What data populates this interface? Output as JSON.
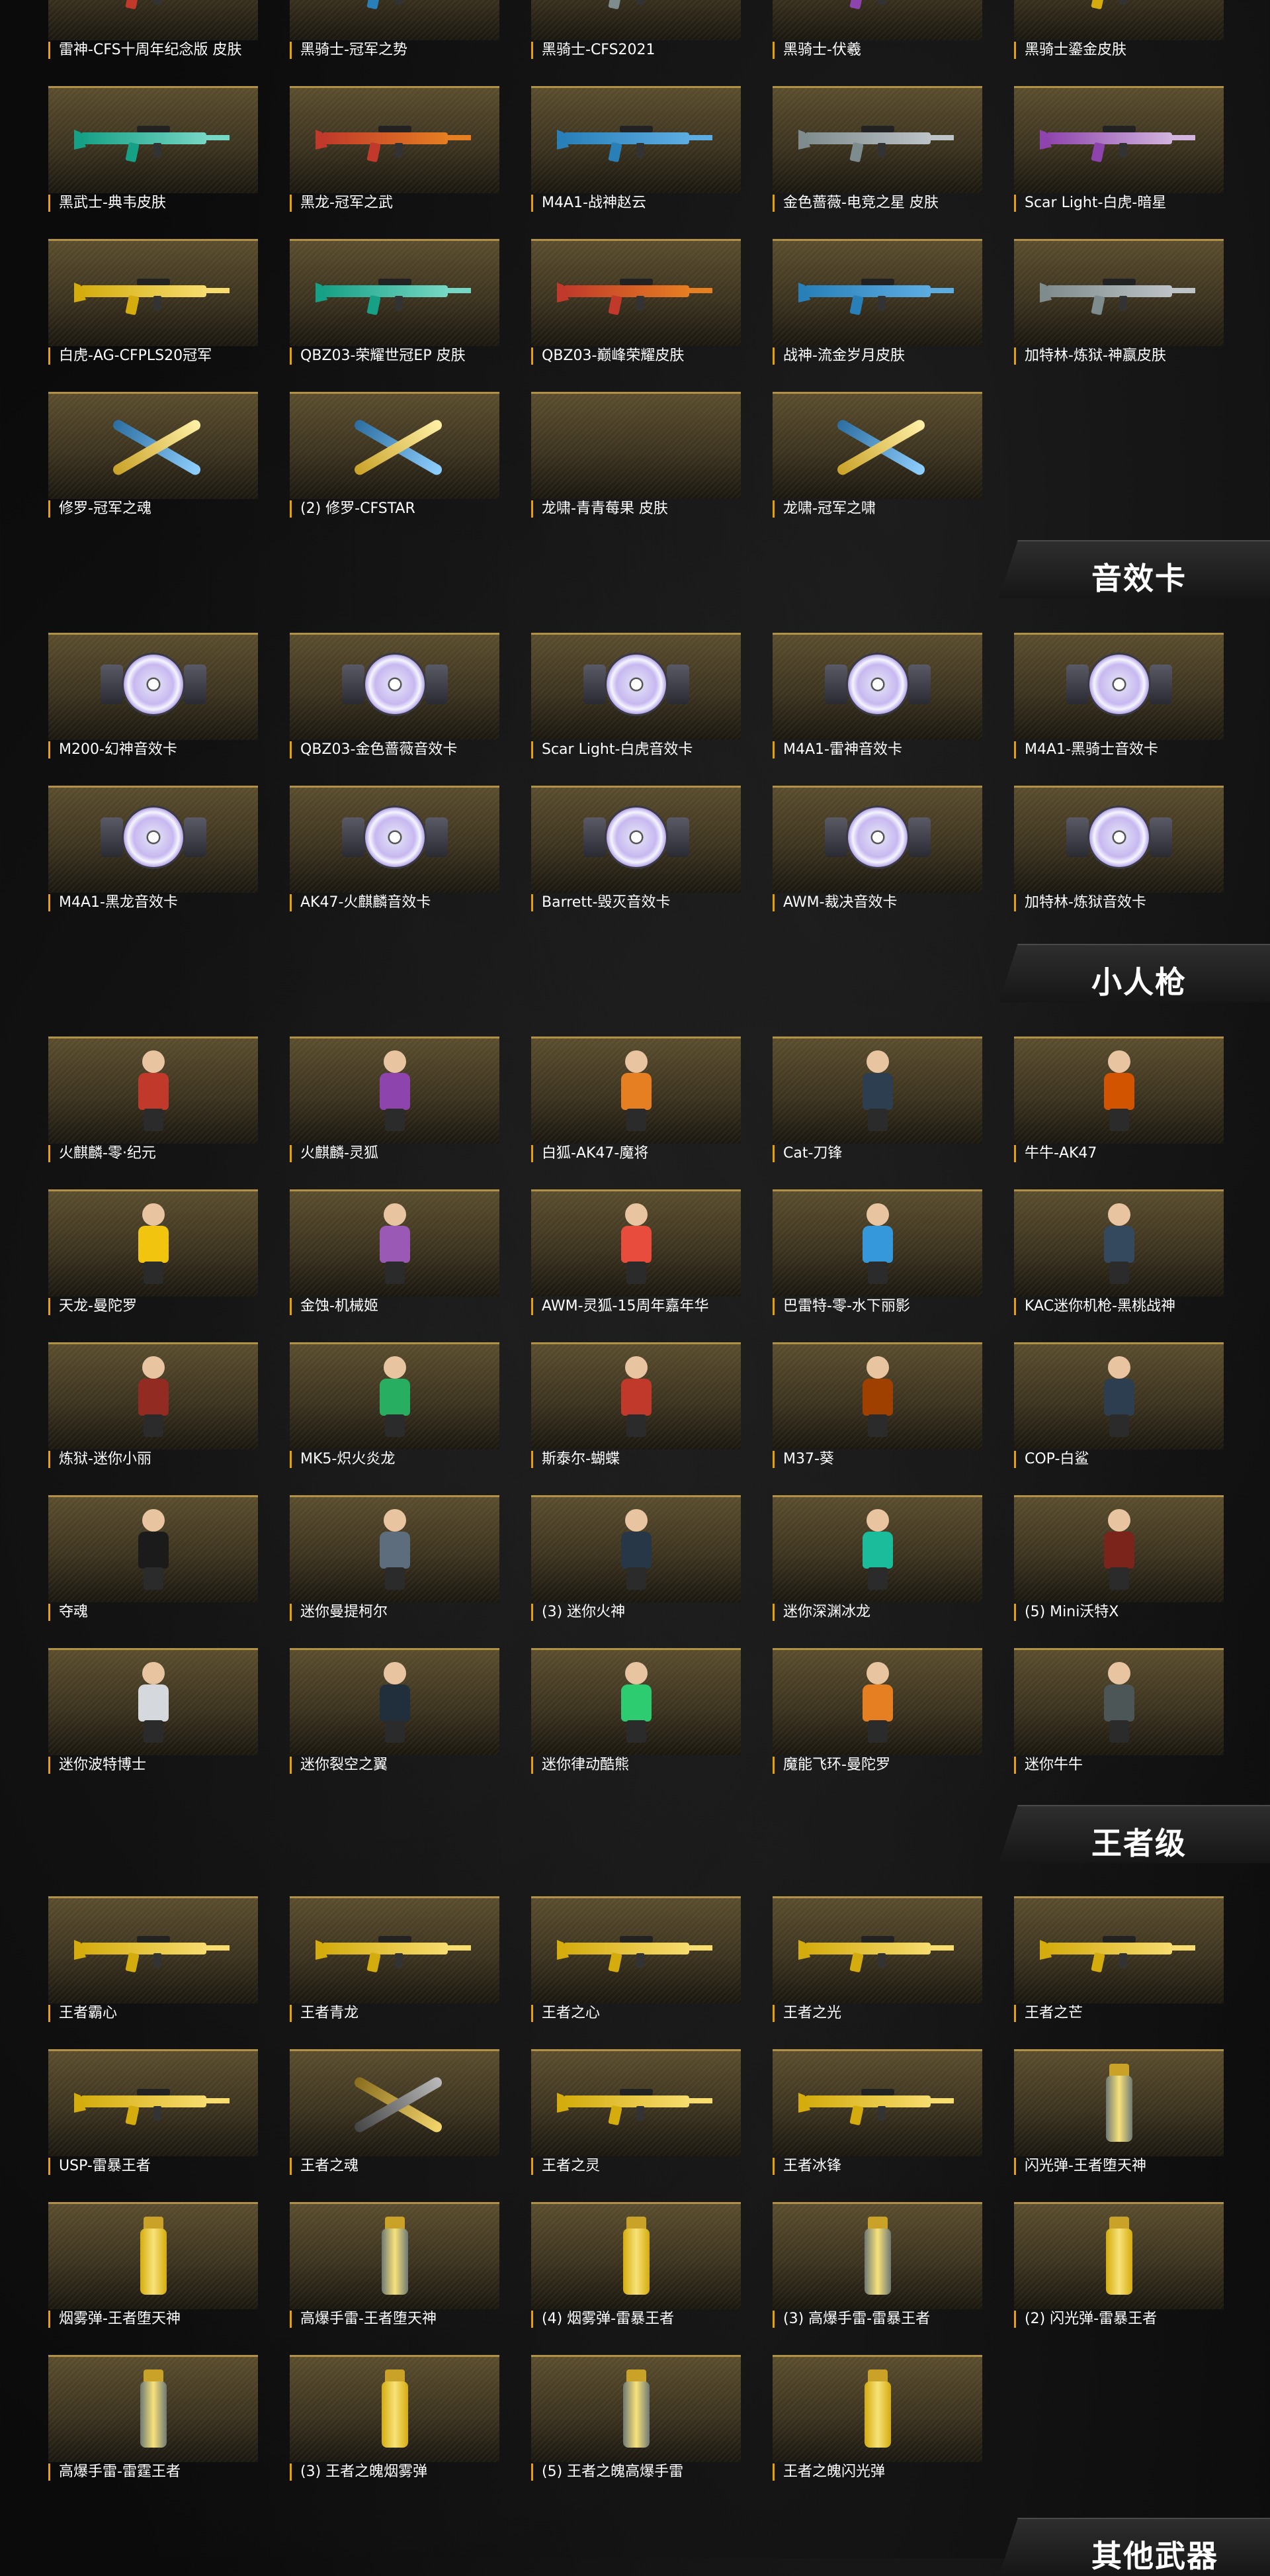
{
  "sections": {
    "sound_card": "音效卡",
    "mini_figure": "小人枪",
    "king_level": "王者级",
    "other_weapons": "其他武器"
  },
  "skins_items": [
    "雷神-CFS十周年纪念版 皮肤",
    "黑骑士-冠军之势",
    "黑骑士-CFS2021",
    "黑骑士-伏羲",
    "黑骑士鎏金皮肤",
    "黑武士-典韦皮肤",
    "黑龙-冠军之武",
    "M4A1-战神赵云",
    "金色蔷薇-电竞之星 皮肤",
    "Scar Light-白虎-暗星",
    "白虎-AG-CFPLS20冠军",
    "QBZ03-荣耀世冠EP 皮肤",
    "QBZ03-巅峰荣耀皮肤",
    "战神-流金岁月皮肤",
    "加特林-炼狱-神嬴皮肤",
    "修罗-冠军之魂",
    "(2) 修罗-CFSTAR",
    "龙啸-青青莓果 皮肤",
    "龙啸-冠军之啸"
  ],
  "sound_items": [
    "M200-幻神音效卡",
    "QBZ03-金色蔷薇音效卡",
    "Scar Light-白虎音效卡",
    "M4A1-雷神音效卡",
    "M4A1-黑骑士音效卡",
    "M4A1-黑龙音效卡",
    "AK47-火麒麟音效卡",
    "Barrett-毁灭音效卡",
    "AWM-裁决音效卡",
    "加特林-炼狱音效卡"
  ],
  "mini_items": [
    "火麒麟-零·纪元",
    "火麒麟-灵狐",
    "白狐-AK47-魔将",
    "Cat-刀锋",
    "牛牛-AK47",
    "天龙-曼陀罗",
    "金蚀-机械姬",
    "AWM-灵狐-15周年嘉年华",
    "巴雷特-零-水下丽影",
    "KAC迷你机枪-黑桃战神",
    "炼狱-迷你小丽",
    "MK5-炽火炎龙",
    "斯泰尔-蝴蝶",
    "M37-葵",
    "COP-白鲨",
    "夺魂",
    "迷你曼提柯尔",
    "(3) 迷你火神",
    "迷你深渊冰龙",
    "(5) Mini沃特X",
    "迷你波特博士",
    "迷你裂空之翼",
    "迷你律动酷熊",
    "魔能飞环-曼陀罗",
    "迷你牛牛"
  ],
  "king_items": [
    "王者霸心",
    "王者青龙",
    "王者之心",
    "王者之光",
    "王者之芒",
    "USP-雷暴王者",
    "王者之魂",
    "王者之灵",
    "王者冰锋",
    "闪光弹-王者堕天神",
    "烟雾弹-王者堕天神",
    "高爆手雷-王者堕天神",
    "(4) 烟雾弹-雷暴王者",
    "(3) 高爆手雷-雷暴王者",
    "(2) 闪光弹-雷暴王者",
    "高爆手雷-雷霆王者",
    "(3) 王者之魄烟雾弹",
    "(5) 王者之魄高爆手雷",
    "王者之魄闪光弹"
  ]
}
